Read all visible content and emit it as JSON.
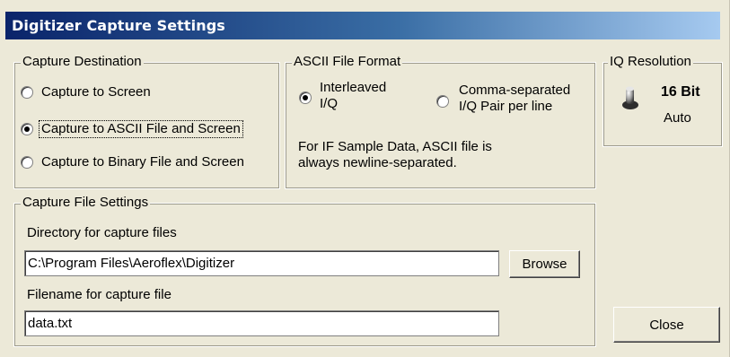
{
  "window": {
    "title": "Digitizer Capture Settings"
  },
  "capture_destination": {
    "legend": "Capture Destination",
    "options": [
      {
        "label": "Capture to Screen",
        "checked": false
      },
      {
        "label": "Capture to ASCII File and Screen",
        "checked": true
      },
      {
        "label": "Capture to Binary File and Screen",
        "checked": false
      }
    ]
  },
  "ascii_format": {
    "legend": "ASCII File Format",
    "interleaved_line1": "Interleaved",
    "interleaved_line2": "I/Q",
    "interleaved_checked": true,
    "comma_line1": "Comma-separated",
    "comma_line2": "I/Q Pair per line",
    "comma_checked": false,
    "note_line1": "For IF Sample Data, ASCII file is",
    "note_line2": "always newline-separated."
  },
  "iq_resolution": {
    "legend": "IQ Resolution",
    "value": "16 Bit",
    "mode": "Auto",
    "icon": "toggle-switch-icon"
  },
  "capture_file": {
    "legend": "Capture File Settings",
    "directory_label": "Directory for capture files",
    "directory_value": "C:\\Program Files\\Aeroflex\\Digitizer",
    "browse_label": "Browse",
    "filename_label": "Filename for capture file",
    "filename_value": "data.txt"
  },
  "close_label": "Close"
}
